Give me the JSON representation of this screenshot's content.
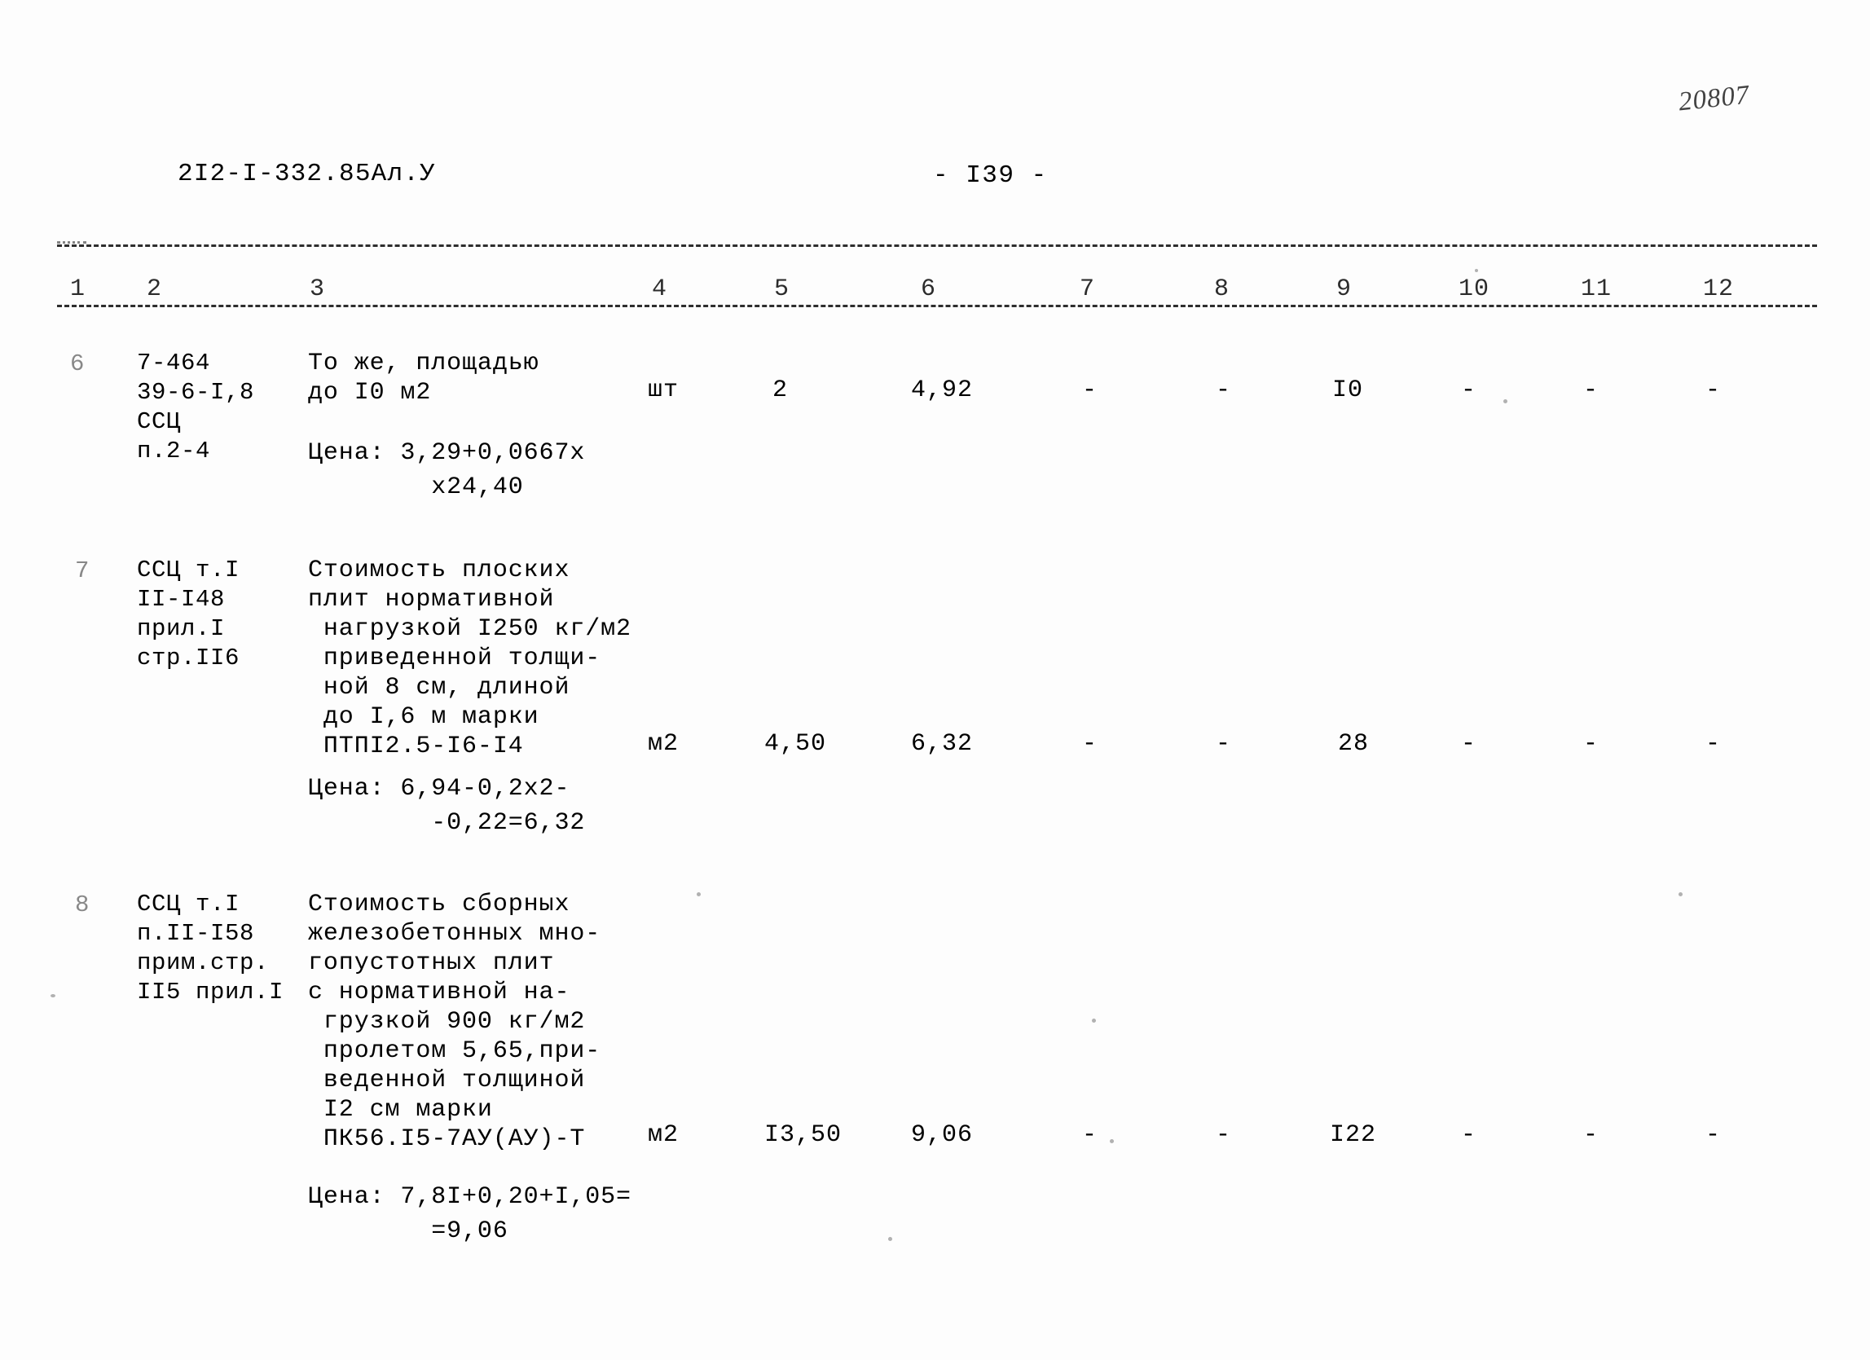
{
  "header": {
    "doc_code": "2I2-I-332.85Ал.У",
    "page_label": "- I39 -",
    "handwritten_note": "20807"
  },
  "table": {
    "column_numbers": [
      "1",
      "2",
      "3",
      "4",
      "5",
      "6",
      "7",
      "8",
      "9",
      "10",
      "11",
      "12"
    ],
    "rows": [
      {
        "num": "6",
        "code": "7-464\n39-6-I,8\nССЦ\nп.2-4",
        "description": "То же, площадью\nдо I0 м2",
        "price_note": "Цена: 3,29+0,0667х\n        х24,40",
        "unit": "шт",
        "col5": "2",
        "col6": "4,92",
        "col7": "-",
        "col8": "-",
        "col9": "I0",
        "col10": "-",
        "col11": "-",
        "col12": "-"
      },
      {
        "num": "7",
        "code": "ССЦ т.I\nII-I48\nприл.I\nстр.II6",
        "description": "Стоимость плоских\nплит нормативной\n нагрузкой I250 кг/м2\n приведенной толщи-\n ной 8 см, длиной\n до I,6 м марки\n ПТПI2.5-I6-I4",
        "price_note": "Цена: 6,94-0,2х2-\n        -0,22=6,32",
        "unit": "м2",
        "col5": "4,50",
        "col6": "6,32",
        "col7": "-",
        "col8": "-",
        "col9": "28",
        "col10": "-",
        "col11": "-",
        "col12": "-"
      },
      {
        "num": "8",
        "code": "ССЦ т.I\nп.II-I58\nприм.стр.\nII5 прил.I",
        "description": "Стоимость сборных\nжелезобетонных мно-\nгопустотных плит\nс нормативной на-\n грузкой 900 кг/м2\n пролетом 5,65,при-\n веденной толщиной\n I2 см марки\n ПК56.I5-7АУ(АУ)-Т",
        "price_note": "Цена: 7,8I+0,20+I,05=\n        =9,06",
        "unit": "м2",
        "col5": "I3,50",
        "col6": "9,06",
        "col7": "-",
        "col8": "-",
        "col9": "I22",
        "col10": "-",
        "col11": "-",
        "col12": "-"
      }
    ]
  }
}
